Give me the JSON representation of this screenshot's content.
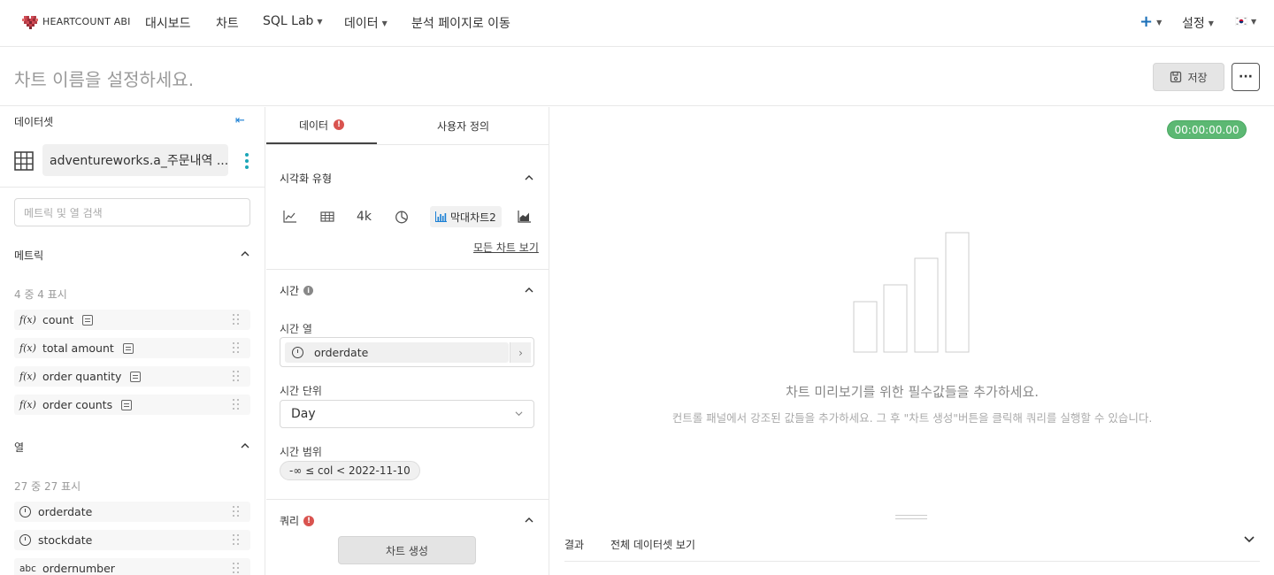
{
  "nav": {
    "logo_text": "HEARTCOUNT ABI",
    "items": [
      {
        "label": "대시보드",
        "has_caret": false
      },
      {
        "label": "차트",
        "has_caret": false
      },
      {
        "label": "SQL Lab",
        "has_caret": true
      },
      {
        "label": "데이터",
        "has_caret": true
      },
      {
        "label": "분석 페이지로 이동",
        "has_caret": false
      }
    ],
    "add_icon": "plus-icon",
    "settings_label": "설정",
    "language_icon": "korean-flag-icon"
  },
  "titlebar": {
    "title_placeholder": "차트 이름을 설정하세요.",
    "save_label": "저장",
    "more_label": "···"
  },
  "left": {
    "dataset_label": "데이터셋",
    "dataset_name": "adventureworks.a_주문내역 ...",
    "search_placeholder": "메트릭 및 열 검색",
    "metrics_label": "메트릭",
    "metrics_count": "4 중 4 표시",
    "metrics": [
      {
        "label": "count"
      },
      {
        "label": "total amount"
      },
      {
        "label": "order quantity"
      },
      {
        "label": "order counts"
      }
    ],
    "columns_label": "열",
    "columns_count": "27 중 27 표시",
    "columns": [
      {
        "label": "orderdate",
        "type": "time"
      },
      {
        "label": "stockdate",
        "type": "time"
      },
      {
        "label": "ordernumber",
        "type": "abc"
      }
    ]
  },
  "middle": {
    "tabs": [
      {
        "label": "데이터",
        "active": true
      },
      {
        "label": "사용자 정의",
        "active": false
      }
    ],
    "viz_section": "시각화 유형",
    "viz_types": [
      "line-chart-icon",
      "table-icon",
      "4k",
      "pie-chart-icon",
      "막대차트2",
      "area-chart-icon"
    ],
    "viz_big_number": "4k",
    "viz_active_label": "막대차트2",
    "all_charts_link": "모든 차트 보기",
    "time_section": "시간",
    "time_column_label": "시간 열",
    "time_column_value": "orderdate",
    "time_grain_label": "시간 단위",
    "time_grain_value": "Day",
    "time_range_label": "시간 범위",
    "time_range_value": "-∞ ≤ col < 2022-11-10",
    "query_section": "쿼리",
    "create_chart_label": "차트 생성"
  },
  "right": {
    "timer": "00:00:00.00",
    "empty_title": "차트 미리보기를 위한 필수값들을 추가하세요.",
    "empty_desc": "컨트롤 패널에서 강조된 값들을 추가하세요. 그 후 \"차트 생성\"버튼을 클릭해 쿼리를 실행할 수 있습니다.",
    "results_tab": "결과",
    "dataset_tab": "전체 데이터셋 보기"
  }
}
